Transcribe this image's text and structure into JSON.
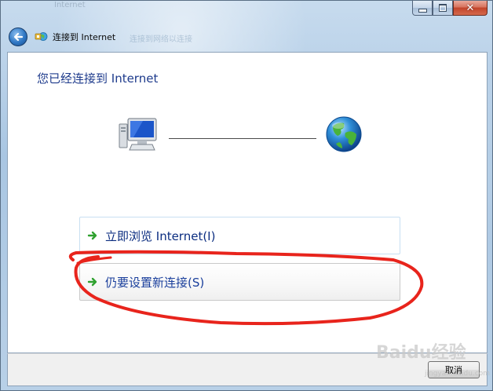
{
  "window": {
    "title": "连接到 Internet",
    "ghost_title": "Internet",
    "ghost_subtitle": "连接到网络以连接",
    "caption": {
      "minimize_icon": "minimize-icon",
      "maximize_icon": "maximize-icon",
      "close_icon": "close-icon",
      "close_glyph": "✕"
    }
  },
  "nav": {
    "back_icon": "back-arrow-icon",
    "title_icon": "network-connection-icon"
  },
  "main": {
    "heading": "您已经连接到 Internet",
    "diagram": {
      "left_icon": "computer-icon",
      "right_icon": "globe-icon",
      "connection": "connected"
    },
    "options": [
      {
        "label": "立即浏览 Internet(I)",
        "icon": "green-arrow-icon"
      },
      {
        "label": "仍要设置新连接(S)",
        "icon": "green-arrow-icon"
      }
    ]
  },
  "footer": {
    "cancel_label": "取消"
  },
  "overlay": {
    "watermark": "Baidu经验",
    "watermark_sub": "jingyan.baidu.com",
    "annotation_color": "#e8241c",
    "annotation": "red-circle-around-second-option"
  },
  "colors": {
    "heading": "#1e3b8c",
    "link": "#0b2d80",
    "arrow": "#2fa12f",
    "panel": "#ffffff",
    "footer": "#f0f0f0",
    "frame": "#b9d1e6"
  }
}
